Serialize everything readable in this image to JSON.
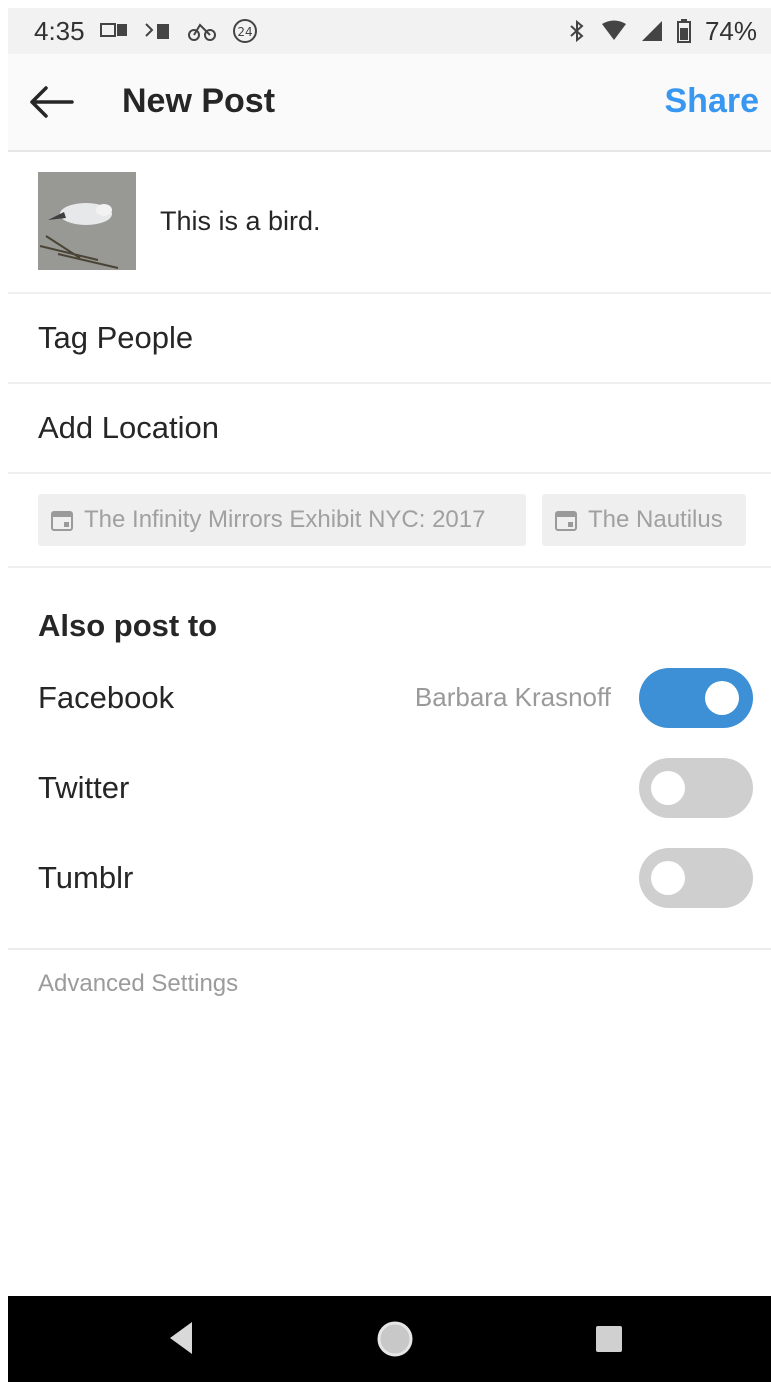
{
  "status_bar": {
    "time": "4:35",
    "battery": "74%",
    "left_icons": [
      "notification-icon",
      "sim-icon",
      "bike-icon",
      "weather-icon"
    ],
    "right_icons": [
      "bluetooth-icon",
      "wifi-icon",
      "signal-icon",
      "battery-icon"
    ]
  },
  "header": {
    "title": "New Post",
    "share_label": "Share",
    "share_color": "#3897f0"
  },
  "post": {
    "caption": "This is a bird."
  },
  "options": {
    "tag_people": "Tag People",
    "add_location": "Add Location"
  },
  "location_suggestions": [
    {
      "label": "The Infinity Mirrors Exhibit NYC: 2017"
    },
    {
      "label": "The Nautilus"
    }
  ],
  "also_post_to": {
    "title": "Also post to",
    "items": [
      {
        "name": "Facebook",
        "account": "Barbara Krasnoff",
        "enabled": true
      },
      {
        "name": "Twitter",
        "account": "",
        "enabled": false
      },
      {
        "name": "Tumblr",
        "account": "",
        "enabled": false
      }
    ]
  },
  "advanced_settings": "Advanced Settings",
  "colors": {
    "toggle_on": "#3d8fd6",
    "toggle_off": "#cfcfcf"
  }
}
